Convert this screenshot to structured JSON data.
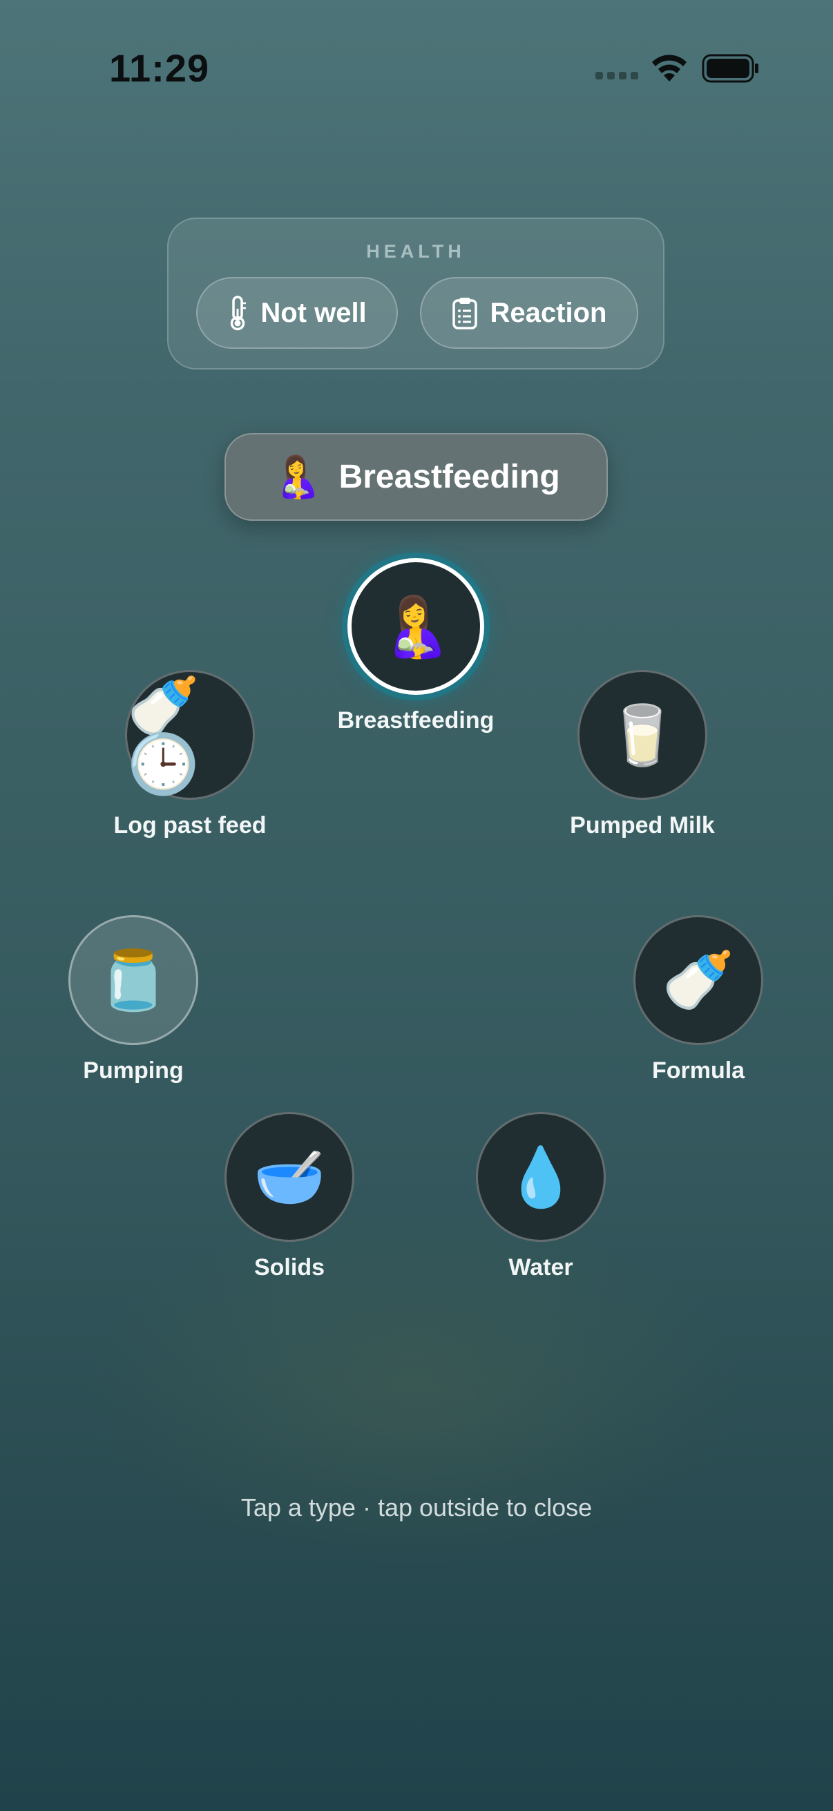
{
  "status_bar": {
    "time": "11:29"
  },
  "health": {
    "title": "HEALTH",
    "buttons": [
      {
        "label": "Not well",
        "icon": "thermometer-icon"
      },
      {
        "label": "Reaction",
        "icon": "clipboard-icon"
      }
    ]
  },
  "selected": {
    "emoji": "🤱",
    "label": "Breastfeeding"
  },
  "options": [
    {
      "id": "breastfeeding",
      "label": "Breastfeeding",
      "emoji": "🤱",
      "active": true
    },
    {
      "id": "log-past-feed",
      "label": "Log past feed",
      "emoji": "🍼🕒"
    },
    {
      "id": "pumped-milk",
      "label": "Pumped Milk",
      "emoji": "🥛"
    },
    {
      "id": "pumping",
      "label": "Pumping",
      "emoji": "🫙"
    },
    {
      "id": "formula",
      "label": "Formula",
      "emoji": "🍼"
    },
    {
      "id": "solids",
      "label": "Solids",
      "emoji": "🥣"
    },
    {
      "id": "water",
      "label": "Water",
      "emoji": "💧"
    }
  ],
  "hint": "Tap a type · tap outside to close",
  "colors": {
    "active_ring": "#1d8fa0",
    "circle_bg": "#202e31"
  }
}
